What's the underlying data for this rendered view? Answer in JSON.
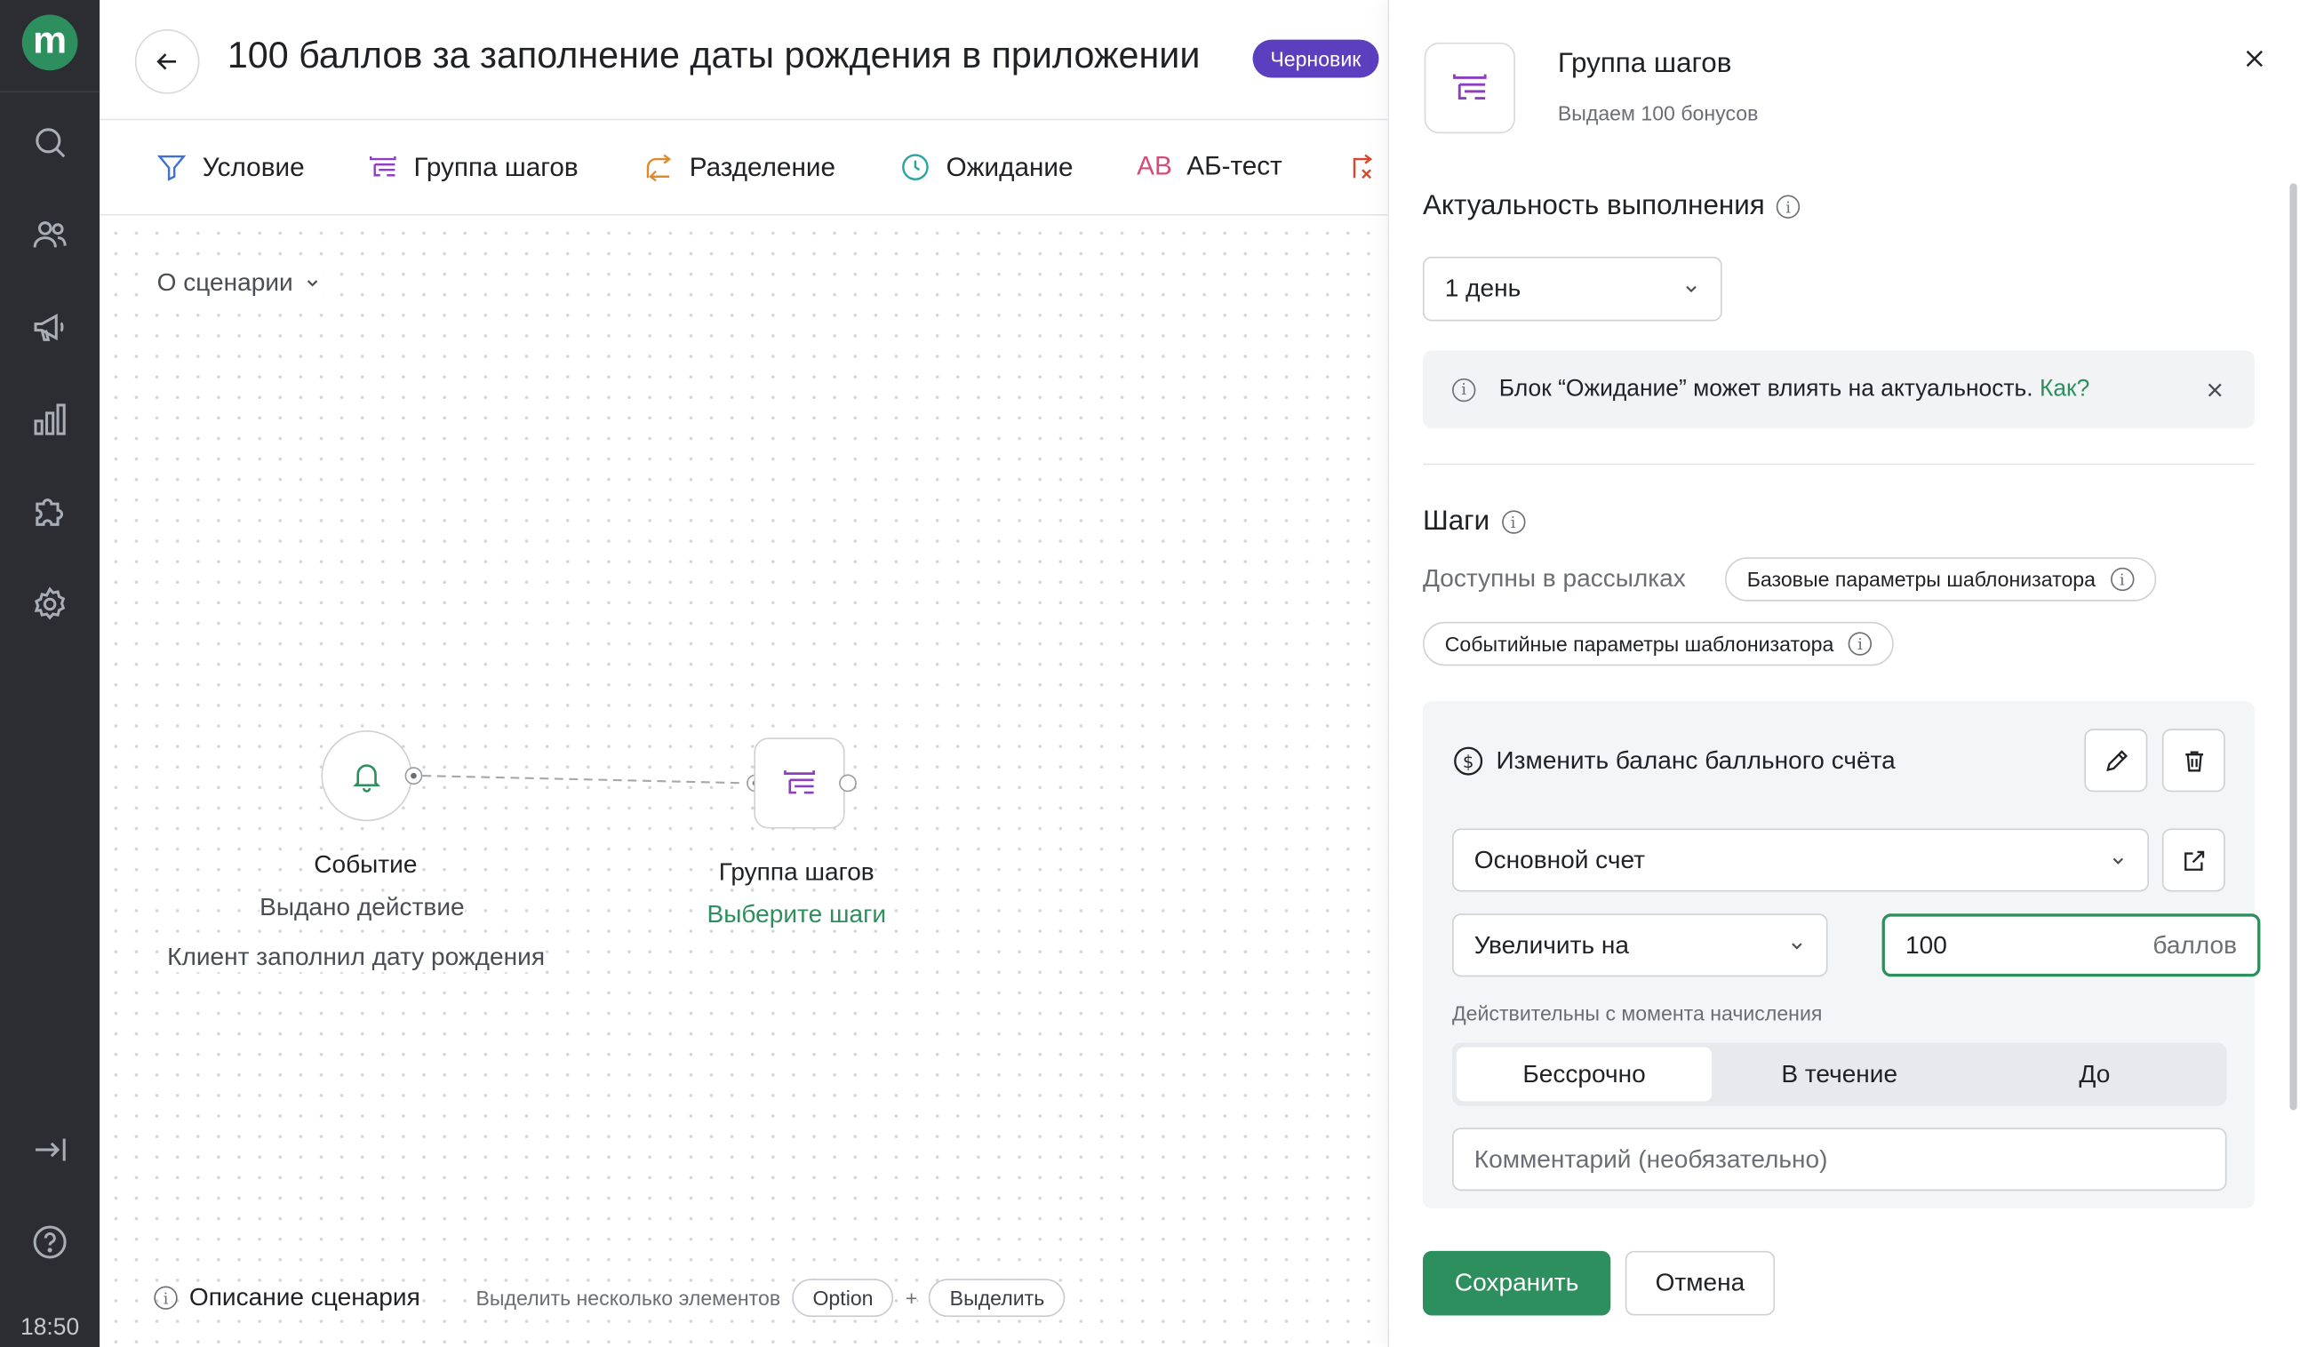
{
  "clock": "18:50",
  "sidebar": {
    "logo": "m",
    "items": [
      {
        "icon": "search-icon"
      },
      {
        "icon": "users-icon"
      },
      {
        "icon": "megaphone-icon"
      },
      {
        "icon": "chart-icon"
      },
      {
        "icon": "puzzle-icon"
      },
      {
        "icon": "gear-icon"
      },
      {
        "icon": "expand-icon"
      },
      {
        "icon": "help-icon"
      }
    ]
  },
  "header": {
    "title": "100 баллов за заполнение даты рождения в приложении",
    "status": "Черновик"
  },
  "toolbar": {
    "condition": "Условие",
    "step_group": "Группа шагов",
    "split": "Разделение",
    "wait": "Ожидание",
    "ab_test": "АБ-тест",
    "ab_glyph": "AB"
  },
  "canvas": {
    "about": "О сценарии",
    "event_node": {
      "title": "Событие",
      "subtitle": "Выдано действие",
      "detail": "Клиент заполнил дату рождения"
    },
    "group_node": {
      "title": "Группа шагов",
      "link": "Выберите шаги"
    },
    "footer": {
      "description": "Описание сценария",
      "multi_select": "Выделить несколько элементов",
      "key": "Option",
      "plus": "+",
      "action": "Выделить"
    }
  },
  "panel": {
    "title": "Группа шагов",
    "subtitle": "Выдаем 100 бонусов",
    "relevance_title": "Актуальность выполнения",
    "relevance_value": "1 день",
    "alert_text": "Блок “Ожидание” может влиять на актуальность.",
    "alert_link": "Как?",
    "steps_title": "Шаги",
    "available_label": "Доступны в рассылках",
    "pill_base": "Базовые параметры шаблонизатора",
    "pill_event": "Событийные параметры шаблонизатора",
    "step": {
      "title": "Изменить баланс балльного счёта",
      "account": "Основной счет",
      "operation": "Увеличить на",
      "amount": "100",
      "units": "баллов",
      "valid_label": "Действительны с момента начисления",
      "segments": [
        "Бессрочно",
        "В течение",
        "До"
      ],
      "active_segment": "Бессрочно",
      "comment_placeholder": "Комментарий (необязательно)"
    },
    "save": "Сохранить",
    "cancel": "Отмена"
  },
  "colors": {
    "accent": "#2e8f5e",
    "badge": "#5b3fbf",
    "sidebar": "#2b2d33"
  }
}
